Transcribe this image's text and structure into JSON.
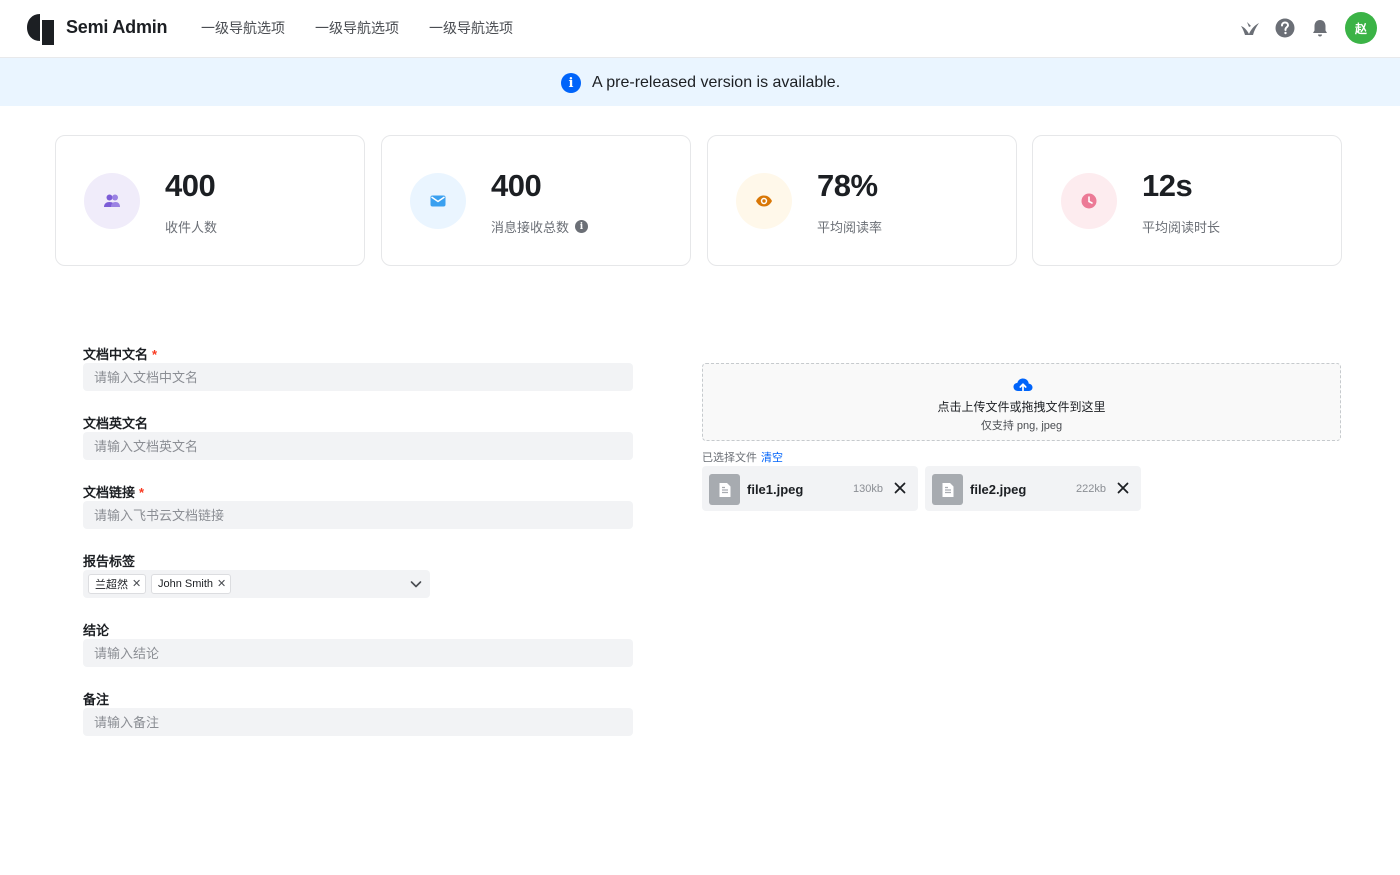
{
  "header": {
    "brand": "Semi Admin",
    "nav": [
      "一级导航选项",
      "一级导航选项",
      "一级导航选项"
    ],
    "icons": [
      "semi-bird-icon",
      "help-icon",
      "bell-icon"
    ],
    "avatar_text": "赵",
    "avatar_color": "#3bb346"
  },
  "banner": {
    "text": "A pre-released version is available.",
    "icon": "info-icon"
  },
  "stats": [
    {
      "value": "400",
      "label": "收件人数",
      "icon": "users-icon",
      "color": "#6a3ac7"
    },
    {
      "value": "400",
      "label": "消息接收总数",
      "icon": "mail-icon",
      "color": "#2d8ae0",
      "has_info": true
    },
    {
      "value": "78%",
      "label": "平均阅读率",
      "icon": "eye-icon",
      "color": "#d97706"
    },
    {
      "value": "12s",
      "label": "平均阅读时长",
      "icon": "clock-icon",
      "color": "#e6557a"
    }
  ],
  "form": {
    "doc_cn_name": {
      "label": "文档中文名",
      "required": "*",
      "placeholder": "请输入文档中文名"
    },
    "doc_en_name": {
      "label": "文档英文名",
      "placeholder": "请输入文档英文名"
    },
    "doc_link": {
      "label": "文档链接",
      "required": "*",
      "placeholder": "请输入飞书云文档链接"
    },
    "report_tags": {
      "label": "报告标签",
      "tags": [
        "兰超然",
        "John Smith"
      ]
    },
    "conclusion": {
      "label": "结论",
      "placeholder": "请输入结论"
    },
    "remark": {
      "label": "备注",
      "placeholder": "请输入备注"
    }
  },
  "upload": {
    "main_text": "点击上传文件或拖拽文件到这里",
    "sub_text": "仅支持 png, jpeg",
    "chosen_label": "已选择文件",
    "clear_label": "清空",
    "files": [
      {
        "name": "file1.jpeg",
        "size": "130kb"
      },
      {
        "name": "file2.jpeg",
        "size": "222kb"
      }
    ]
  }
}
